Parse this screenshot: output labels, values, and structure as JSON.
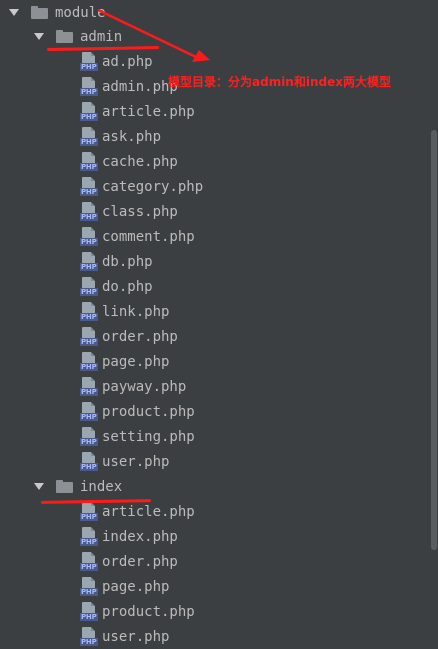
{
  "tree": {
    "root": {
      "label": "module"
    },
    "admin": {
      "label": "admin",
      "files": [
        "ad.php",
        "admin.php",
        "article.php",
        "ask.php",
        "cache.php",
        "category.php",
        "class.php",
        "comment.php",
        "db.php",
        "do.php",
        "link.php",
        "order.php",
        "page.php",
        "payway.php",
        "product.php",
        "setting.php",
        "user.php"
      ]
    },
    "index": {
      "label": "index",
      "files": [
        "article.php",
        "index.php",
        "order.php",
        "page.php",
        "product.php",
        "user.php"
      ]
    },
    "file_icon_label": "PHP"
  },
  "annotation": {
    "text": "模型目录：分为admin和index两大模型",
    "color": "#ff2020"
  },
  "colors": {
    "background": "#3c3f41",
    "text": "#bbbbbb",
    "annotation_red": "#ff1a1a"
  }
}
